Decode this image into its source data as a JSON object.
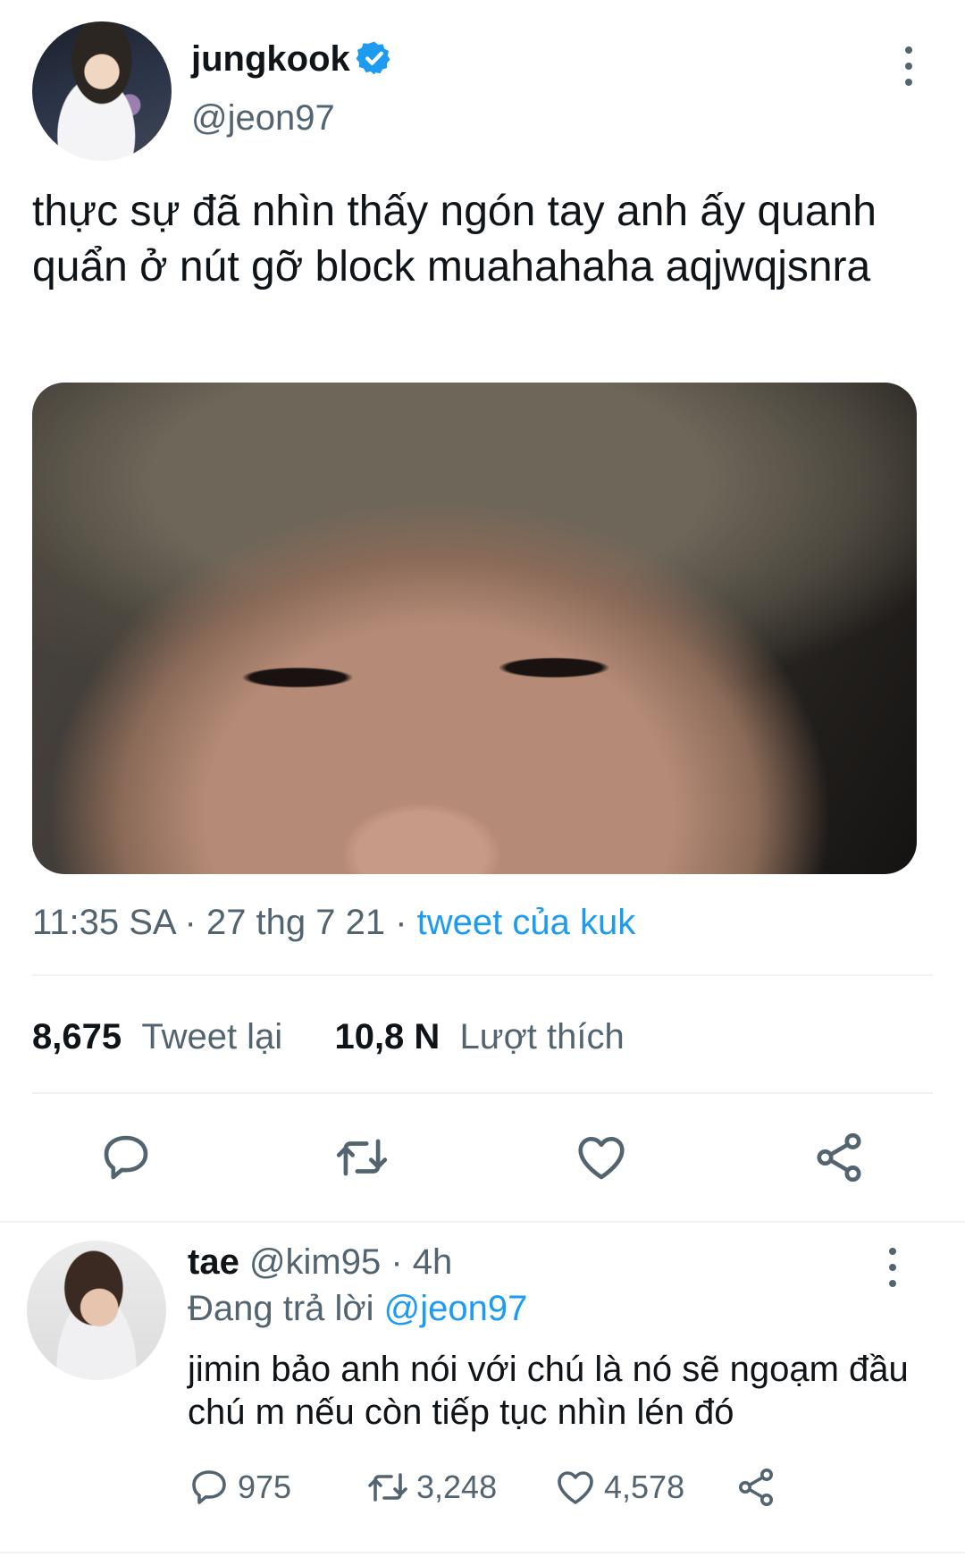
{
  "tweet": {
    "author_name": "jungkook",
    "author_handle": "@jeon97",
    "text": "thực sự đã nhìn thấy ngón tay anh ấy quanh quẩn ở nút gỡ block muahahaha aqjwqjsnra",
    "time": "11:35 SA · 27 thg 7 21 · ",
    "source": "tweet của kuk",
    "retweets_count": "8,675",
    "retweets_label": "Tweet lại",
    "likes_count": "10,8 N",
    "likes_label": "Lượt thích"
  },
  "reply": {
    "author_name": "tae",
    "author_handle": "@kim95",
    "age": " · 4h",
    "replying_prefix": "Đang trả lời ",
    "replying_to": "@jeon97",
    "text": "jimin bảo anh nói với chú là nó sẽ ngoạm đầu chú m nếu còn tiếp tục nhìn lén đó",
    "reply_count": "975",
    "retweet_count": "3,248",
    "like_count": "4,578"
  },
  "icons": {
    "verified": "verified-badge-icon",
    "more": "more-vertical-icon",
    "reply": "reply-icon",
    "retweet": "retweet-icon",
    "like": "heart-icon",
    "share": "share-icon"
  },
  "colors": {
    "accent": "#1d9bf0",
    "secondary_text": "#536471",
    "primary_text": "#0f1419"
  }
}
